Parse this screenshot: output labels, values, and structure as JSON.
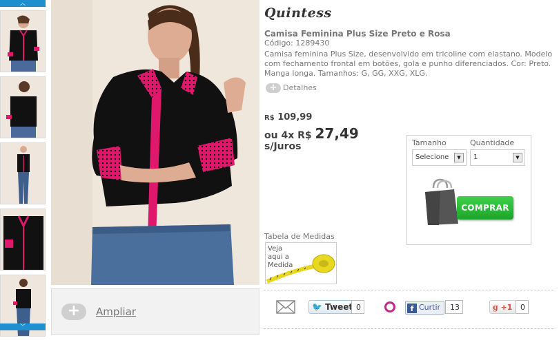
{
  "gallery": {
    "up_arrow": "︿",
    "down_arrow": "﹀",
    "zoom_label": "Ampliar",
    "zoom_plus": "+"
  },
  "product": {
    "brand": "Quintess",
    "title": "Camisa Feminina Plus Size Preto e Rosa",
    "code": "Código: 1289430",
    "description": "Camisa feminina Plus Size, desenvolvido em tricoline com elastano. Modelo com fechamento frontal em botões, gola e punho diferenciados. Cor: Preto. Manga longa. Tamanhos: G, GG, XXG, XLG.",
    "details_label": "Detalhes",
    "details_plus": "+"
  },
  "pricing": {
    "currency": "R$",
    "price": "109,99",
    "installment_prefix": "ou 4x",
    "installment_value": "27,49",
    "terms": "s/Juros"
  },
  "purchase": {
    "size_label": "Tamanho",
    "size_value": "Selecione",
    "qty_label": "Quantidade",
    "qty_value": "1",
    "buy_label": "COMPRAR"
  },
  "measurements": {
    "label": "Tabela de Medidas",
    "link_text": "Veja aqui a Medida"
  },
  "social": {
    "tweet_label": "Tweet",
    "tweet_count": "0",
    "facebook_label": "Curtir",
    "facebook_count": "13",
    "gplus_label": "+1",
    "gplus_count": "0"
  },
  "colors": {
    "accent_blue": "#1f8fd0",
    "buy_green": "#1aa52a",
    "shirt_black": "#111111",
    "trim_pink": "#e0186c"
  }
}
